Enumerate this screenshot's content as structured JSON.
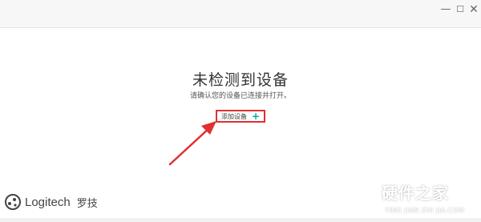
{
  "window": {
    "minimize_label": "—",
    "maximize_label": "☐",
    "close_label": "✕"
  },
  "empty_state": {
    "title": "未检测到设备",
    "subtitle": "请确认您的设备已连接并打开。"
  },
  "add_device": {
    "label": "添加设备",
    "icon": "plus-icon",
    "icon_glyph": "+",
    "icon_color": "#00a99d",
    "highlight_color": "#e03030"
  },
  "brand": {
    "name": "Logitech",
    "name_cn": "罗技"
  },
  "watermark": {
    "title": "硬件之家",
    "subtitle": "YING JIAN ZHI JIA.COM"
  }
}
